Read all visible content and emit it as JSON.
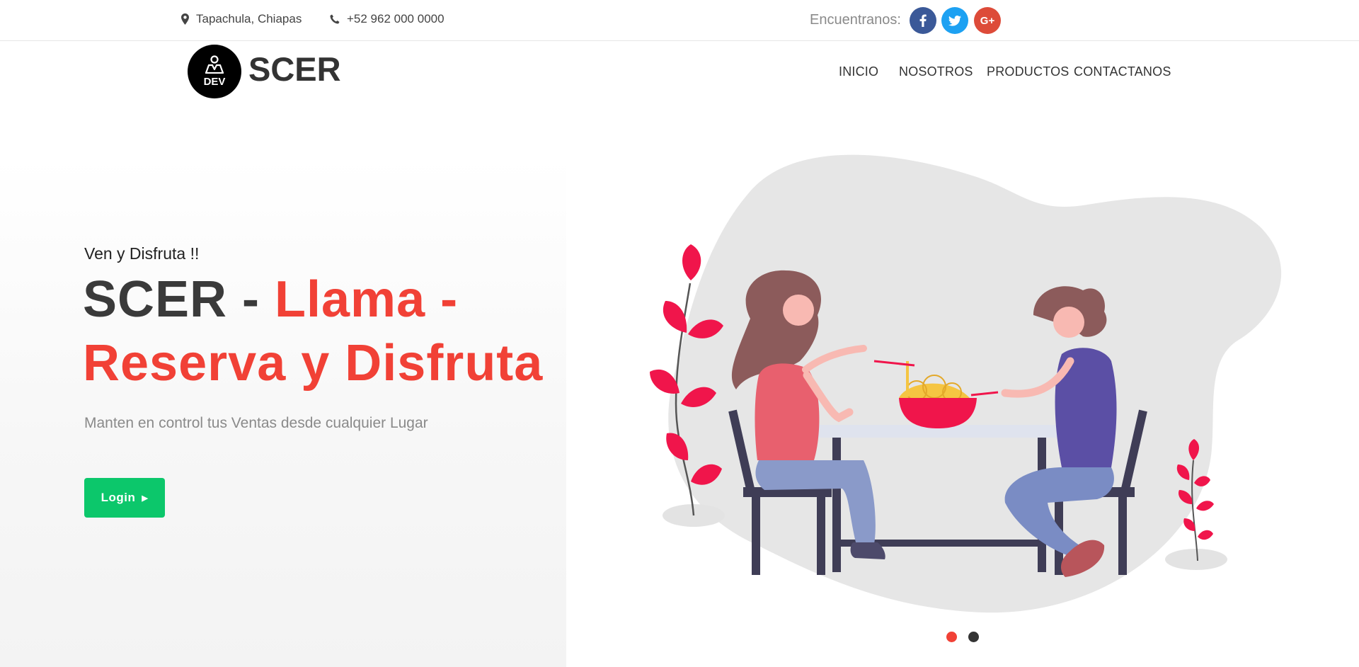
{
  "topbar": {
    "location": "Tapachula, Chiapas",
    "phone": "+52 962 000 0000",
    "find_us": "Encuentranos:",
    "social": [
      {
        "icon": "facebook-icon",
        "glyph": "f",
        "color": "#3b5998"
      },
      {
        "icon": "twitter-icon",
        "glyph": "t",
        "color": "#1da1f2"
      },
      {
        "icon": "google-plus-icon",
        "glyph": "G+",
        "color": "#dd4b39"
      }
    ]
  },
  "header": {
    "logo_badge": "DEV",
    "logo_text": "SCER",
    "nav": [
      "INICIO",
      "NOSOTROS",
      "PRODUCTOS",
      "CONTACTANOS"
    ]
  },
  "hero": {
    "subtitle": "Ven y Disfruta !!",
    "title_dark": "SCER - ",
    "title_red_1": "Llama -",
    "title_red_2": "Reserva y Disfruta",
    "description": "Manten en control tus Ventas desde cualquier Lugar",
    "login_label": "Login"
  },
  "colors": {
    "accent_red": "#f14136",
    "button_green": "#0cc76b",
    "dark_text": "#3a3a3a"
  },
  "carousel": {
    "slides": 2,
    "active": 1
  }
}
